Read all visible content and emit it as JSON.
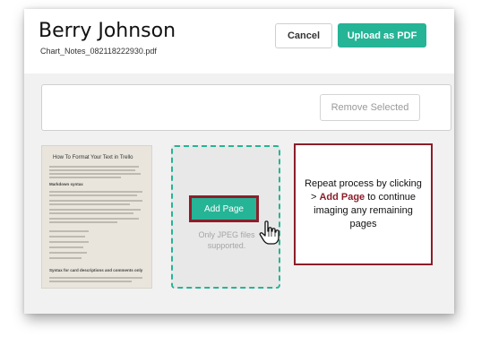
{
  "header": {
    "title": "Berry Johnson",
    "filename": "Chart_Notes_082118222930.pdf",
    "cancel_label": "Cancel",
    "upload_label": "Upload as PDF"
  },
  "toolbar": {
    "remove_label": "Remove Selected"
  },
  "thumbnail": {
    "doc_title": "How To Format Your Text in Trello",
    "heading1": "Markdown syntax",
    "heading2": "Syntax for card descriptions and comments only"
  },
  "dropzone": {
    "add_label": "Add Page",
    "note": "Only JPEG files supported."
  },
  "callout": {
    "text_before": "Repeat process by clicking > ",
    "highlight": "Add Page",
    "text_after": " to continue imaging any remaining pages"
  },
  "colors": {
    "accent": "#25b496",
    "callout_border": "#8b1e2a"
  }
}
